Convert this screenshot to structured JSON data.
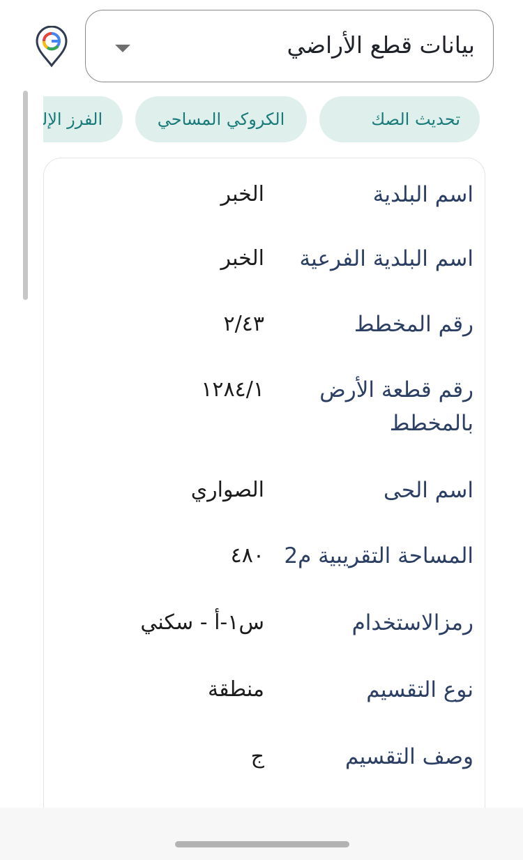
{
  "dropdown": {
    "selected": "بيانات قطع الأراضي"
  },
  "chips": [
    {
      "label": "الفرز الإلكتروني"
    },
    {
      "label": "الكروكي المساحي"
    },
    {
      "label": "تحديث الصك"
    }
  ],
  "details": [
    {
      "label": "اسم البلدية",
      "value": "الخبر"
    },
    {
      "label": "اسم البلدية الفرعية",
      "value": "الخبر"
    },
    {
      "label": "رقم المخطط",
      "value": "٢/٤٣"
    },
    {
      "label": "رقم قطعة الأرض بالمخطط",
      "value": "١٢٨٤/١"
    },
    {
      "label": "اسم الحى",
      "value": "الصواري"
    },
    {
      "label": "المساحة التقريبية م2",
      "value": "٤٨٠"
    },
    {
      "label": "رمزالاستخدام",
      "value": "س١-أ - سكني"
    },
    {
      "label": "نوع التقسيم",
      "value": "منطقة"
    },
    {
      "label": "وصف التقسيم",
      "value": "ج"
    }
  ],
  "icons": {
    "dropdown_caret": "chevron-down-icon",
    "google_pin": "google-location-pin-icon"
  },
  "colors": {
    "chip_bg": "#dff0ec",
    "chip_text": "#197a7a",
    "label_text": "#2b3e64"
  }
}
